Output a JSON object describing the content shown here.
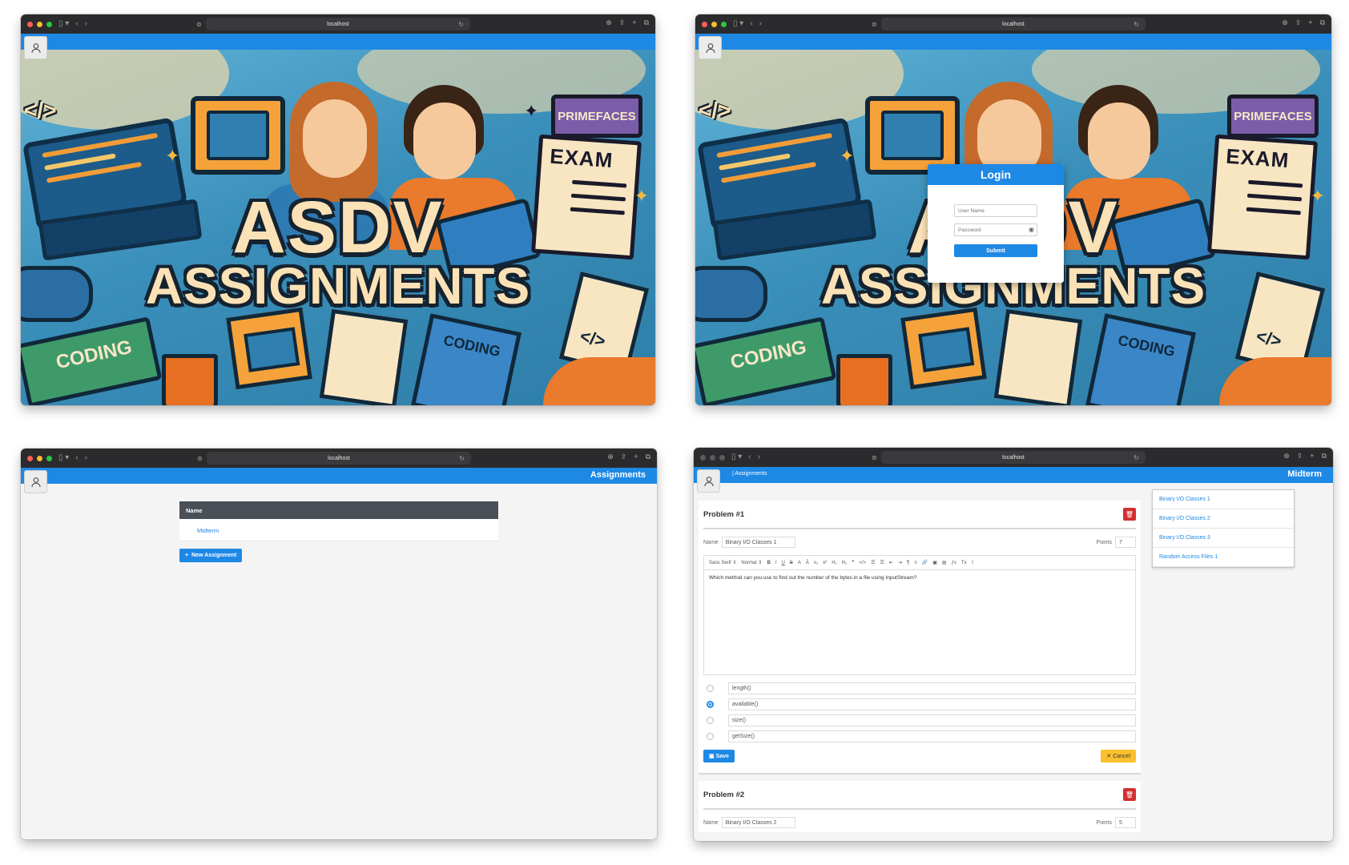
{
  "browser": {
    "url": "localhost"
  },
  "landing": {
    "banner_title": "ASDV",
    "banner_subtitle": "ASSIGNMENTS",
    "banner_tag_primefaces": "PRIMEFACES",
    "banner_tag_exam": "EXAM",
    "banner_tag_coding": "CODING",
    "banner_tag_code": "</>"
  },
  "login": {
    "title": "Login",
    "username_placeholder": "User Name",
    "password_placeholder": "Password",
    "submit_label": "Submit"
  },
  "assignments": {
    "header_title": "Assignments",
    "column_name": "Name",
    "rows": [
      {
        "name": "Midterm"
      }
    ],
    "new_button_label": "New Assignment"
  },
  "editor": {
    "breadcrumb": "| Assignments",
    "header_title": "Midterm",
    "problems": [
      {
        "title": "Problem #1",
        "name_label": "Name",
        "name_value": "Binary I/O Classes 1",
        "points_label": "Points",
        "points_value": "7",
        "toolbar_font": "Sans Serif",
        "toolbar_size": "Normal",
        "question": "Which method can you use to find out the number of the bytes in a file using InputStream?",
        "options": [
          "length()",
          "available()",
          "size()",
          "getSize()"
        ],
        "selected_option": 1,
        "save_label": "Save",
        "cancel_label": "Cancel"
      },
      {
        "title": "Problem #2",
        "name_label": "Name",
        "name_value": "Binary I/O Classes 2",
        "points_label": "Points",
        "points_value": "5"
      }
    ],
    "sidebar_items": [
      "Binary I/O Classes 1",
      "Binary I/O Classes 2",
      "Binary I/O Classes 3",
      "Random Access Files 1"
    ]
  },
  "colors": {
    "primary": "#1e88e5",
    "danger": "#d32f2f",
    "warning": "#fbc02d",
    "table_header": "#495057"
  }
}
